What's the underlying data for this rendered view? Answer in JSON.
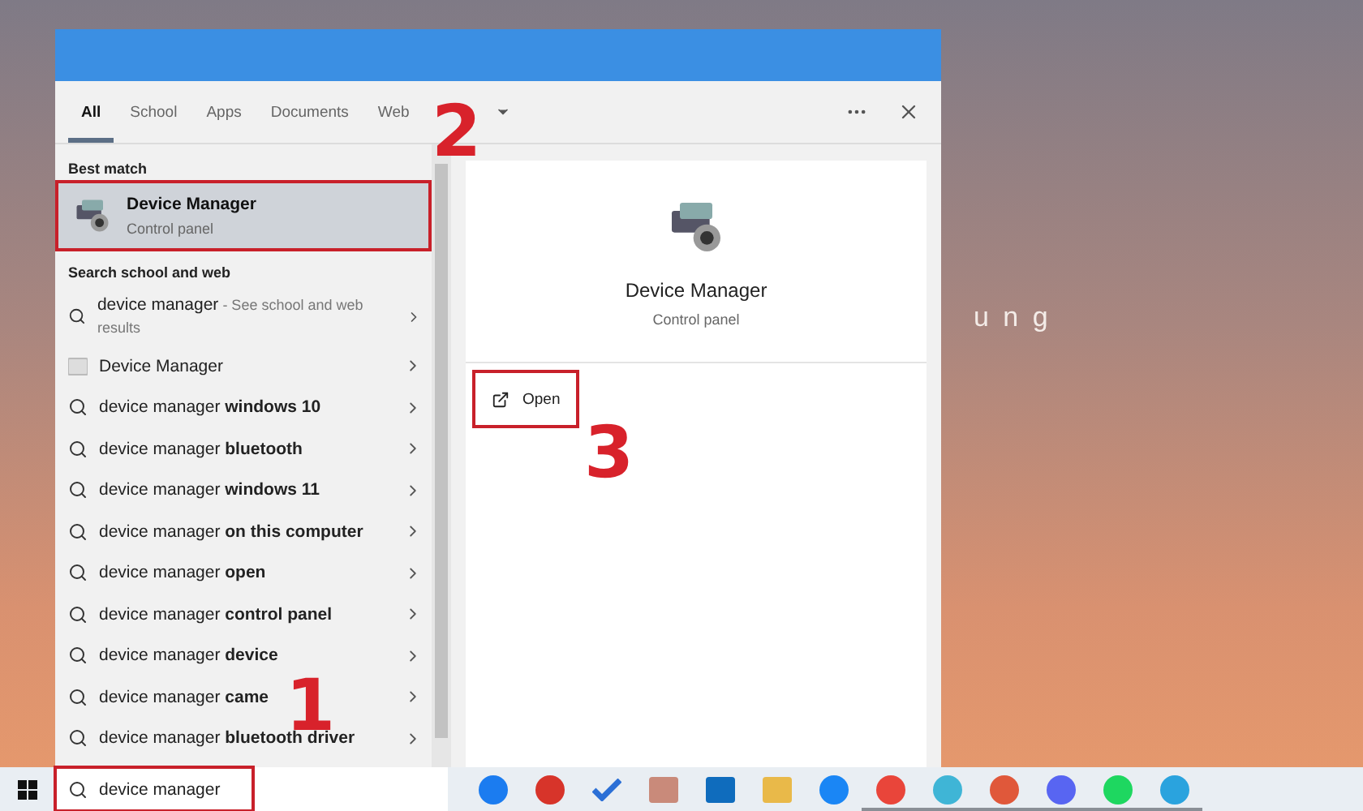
{
  "desktop": {
    "text": "u n g"
  },
  "search_panel": {
    "tabs": [
      {
        "label": "All",
        "selected": true
      },
      {
        "label": "School",
        "selected": false
      },
      {
        "label": "Apps",
        "selected": false
      },
      {
        "label": "Documents",
        "selected": false
      },
      {
        "label": "Web",
        "selected": false
      }
    ],
    "best_match": {
      "heading": "Best match",
      "title": "Device Manager",
      "subtitle": "Control panel",
      "highlighted": true
    },
    "web_heading": "Search school and web",
    "results": [
      {
        "kind": "web",
        "text": "device manager",
        "detail": "- See school and web results"
      },
      {
        "kind": "app",
        "text": "Device Manager"
      },
      {
        "kind": "web",
        "text": "device manager **windows 10**"
      },
      {
        "kind": "web",
        "text": "device manager **bluetooth**"
      },
      {
        "kind": "web",
        "text": "device manager **windows 11**"
      },
      {
        "kind": "web",
        "text": "device manager **on this computer**"
      },
      {
        "kind": "web",
        "text": "device manager **open**"
      },
      {
        "kind": "web",
        "text": "device manager **control panel**"
      },
      {
        "kind": "web",
        "text": "device manager **device**"
      },
      {
        "kind": "web",
        "text": "device manager **came**"
      },
      {
        "kind": "web",
        "text": "device manager **bluetooth driver**"
      }
    ],
    "preview": {
      "title": "Device Manager",
      "subtitle": "Control panel",
      "actions": [
        {
          "label": "Open",
          "highlighted": true
        }
      ]
    }
  },
  "taskbar": {
    "search": {
      "value": "device manager",
      "highlighted": true
    },
    "apps": [
      {
        "kind": "circle",
        "color": "#1b7cf0",
        "running": false
      },
      {
        "kind": "circle",
        "color": "#d7342a",
        "running": false
      },
      {
        "kind": "check",
        "color": "#2b6fd6",
        "running": false
      },
      {
        "kind": "square",
        "color": "#c98a7a",
        "running": false
      },
      {
        "kind": "square",
        "color": "#0f6cbd",
        "running": false
      },
      {
        "kind": "square",
        "color": "#e9b949",
        "running": false
      },
      {
        "kind": "circle",
        "color": "#1a86f5",
        "running": false
      },
      {
        "kind": "circle",
        "color": "#e9453a",
        "running": true
      },
      {
        "kind": "circle",
        "color": "#3fb5d6",
        "running": true
      },
      {
        "kind": "circle",
        "color": "#e0583a",
        "running": true
      },
      {
        "kind": "circle",
        "color": "#5865f2",
        "running": true
      },
      {
        "kind": "circle",
        "color": "#1ed760",
        "running": true
      },
      {
        "kind": "circle",
        "color": "#2aa3de",
        "running": true
      }
    ]
  },
  "annotations": [
    {
      "label": "2"
    },
    {
      "label": "3"
    },
    {
      "label": "1"
    }
  ]
}
